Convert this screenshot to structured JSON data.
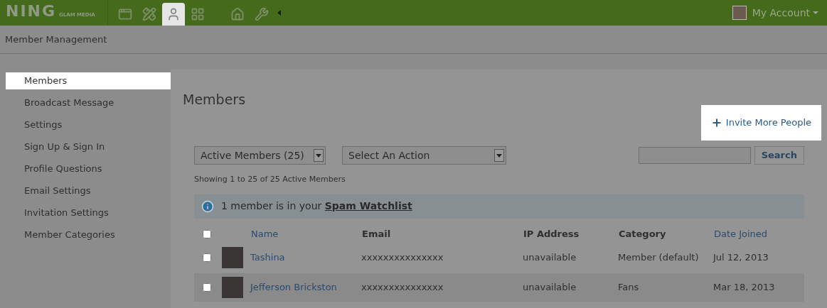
{
  "top_bar": {
    "logo": "NING",
    "logo_sub": "GLAM MEDIA",
    "nav": [
      {
        "kind": "window",
        "selected": false
      },
      {
        "kind": "design",
        "selected": false
      },
      {
        "kind": "member",
        "selected": true
      },
      {
        "kind": "grid",
        "selected": false
      },
      {
        "kind": "home",
        "selected": false
      },
      {
        "kind": "tools",
        "selected": false
      }
    ],
    "account": "My Account"
  },
  "page_title": "Member Management",
  "sidebar": {
    "items": [
      {
        "label": "Members",
        "selected": true
      },
      {
        "label": "Broadcast Message",
        "selected": false
      },
      {
        "label": "Settings",
        "selected": false
      },
      {
        "label": "Sign Up & Sign In",
        "selected": false
      },
      {
        "label": "Profile Questions",
        "selected": false
      },
      {
        "label": "Email Settings",
        "selected": false
      },
      {
        "label": "Invitation Settings",
        "selected": false
      },
      {
        "label": "Member Categories",
        "selected": false
      }
    ]
  },
  "content": {
    "title": "Members",
    "invite_button": "Invite More People",
    "filters": [
      {
        "value": "Active Members (25)"
      },
      {
        "value": "Select An Action"
      }
    ],
    "search_button": "Search",
    "showing": "Showing 1 to 25 of 25 Active Members",
    "alert": {
      "text": "1 member is in your",
      "link": "Spam Watchlist"
    },
    "table": {
      "select_all_checked": false,
      "columns": [
        {
          "label": "Name",
          "sortable": true
        },
        {
          "label": "Email",
          "sortable": false
        },
        {
          "label": "IP Address",
          "sortable": false
        },
        {
          "label": "Category",
          "sortable": false
        },
        {
          "label": "Date Joined",
          "sortable": true
        }
      ],
      "rows": [
        {
          "checked": false,
          "name": "Tashina",
          "email": "xxxxxxxxxxxxxxx",
          "ip": "unavailable",
          "category": "Member (default)",
          "date": "Jul 12, 2013"
        },
        {
          "checked": false,
          "name": "Jefferson Brickston",
          "email": "xxxxxxxxxxxxxxx",
          "ip": "unavailable",
          "category": "Fans",
          "date": "Mar 18, 2013"
        }
      ]
    }
  }
}
